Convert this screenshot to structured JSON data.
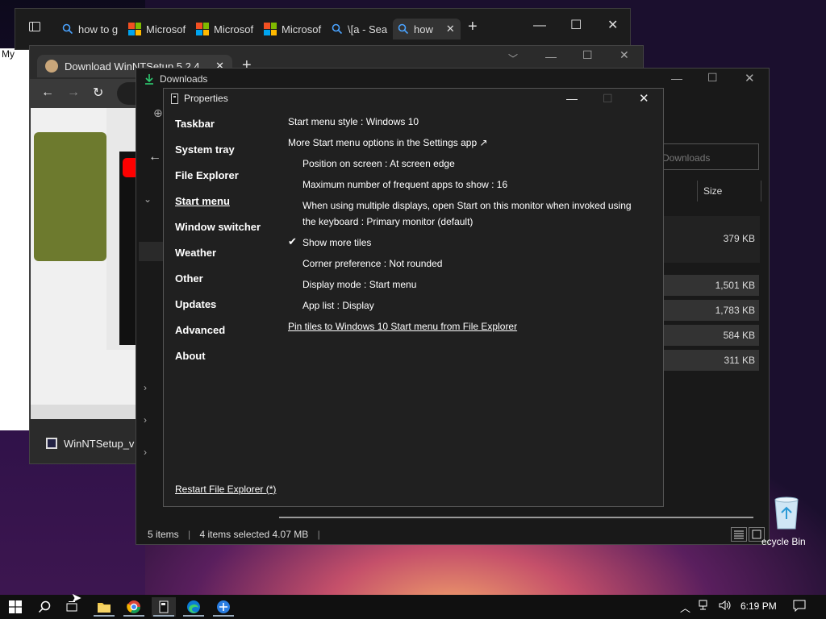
{
  "desktop": {
    "partial_label": "My",
    "recycle_bin_label": "ecycle Bin"
  },
  "edge": {
    "tabs": [
      {
        "label": "how to g",
        "icon": "search-icon"
      },
      {
        "label": "Microsof",
        "icon": "microsoft-logo-icon"
      },
      {
        "label": "Microsof",
        "icon": "microsoft-logo-icon"
      },
      {
        "label": "Microsof",
        "icon": "microsoft-logo-icon"
      },
      {
        "label": "\\[a - Sea",
        "icon": "search-icon"
      },
      {
        "label": "how",
        "icon": "search-icon"
      }
    ],
    "close_tab_glyph": "✕",
    "new_tab_glyph": "+"
  },
  "chrome": {
    "tab_title": "Download WinNTSetup 5.2.4",
    "tab_close": "✕",
    "new_tab": "+",
    "download_item": "WinNTSetup_v"
  },
  "explorer": {
    "title": "Downloads",
    "search_placeholder": "Downloads",
    "column_size": "Size",
    "sizes": [
      "379 KB",
      "1,501 KB",
      "1,783 KB",
      "584 KB",
      "311 KB"
    ],
    "status_items": "5 items",
    "status_selected": "4 items selected  4.07 MB"
  },
  "properties": {
    "title": "Properties",
    "nav": [
      "Taskbar",
      "System tray",
      "File Explorer",
      "Start menu",
      "Window switcher",
      "Weather",
      "Other",
      "Updates",
      "Advanced",
      "About"
    ],
    "active_nav": "Start menu",
    "options": {
      "start_menu_style": "Start menu style : Windows 10",
      "more_options": "More Start menu options in the Settings app ↗",
      "position": "Position on screen : At screen edge",
      "frequent_apps": "Maximum number of frequent apps to show : 16",
      "multi_display_1": "When using multiple displays, open Start on this monitor when invoked using",
      "multi_display_2": "the keyboard : Primary monitor (default)",
      "show_more_tiles": "Show more tiles",
      "corner_pref": "Corner preference : Not rounded",
      "display_mode": "Display mode : Start menu",
      "app_list": "App list : Display",
      "pin_tiles": "Pin tiles to Windows 10 Start menu from File Explorer"
    },
    "show_more_tiles_checked": true,
    "restart_link": "Restart File Explorer (*)"
  },
  "taskbar": {
    "time": "6:19 PM",
    "icons": [
      "windows-start-icon",
      "search-icon",
      "task-view-icon",
      "file-explorer-icon",
      "chrome-icon",
      "explorerpatcher-icon",
      "edge-icon",
      "network-app-icon"
    ]
  }
}
